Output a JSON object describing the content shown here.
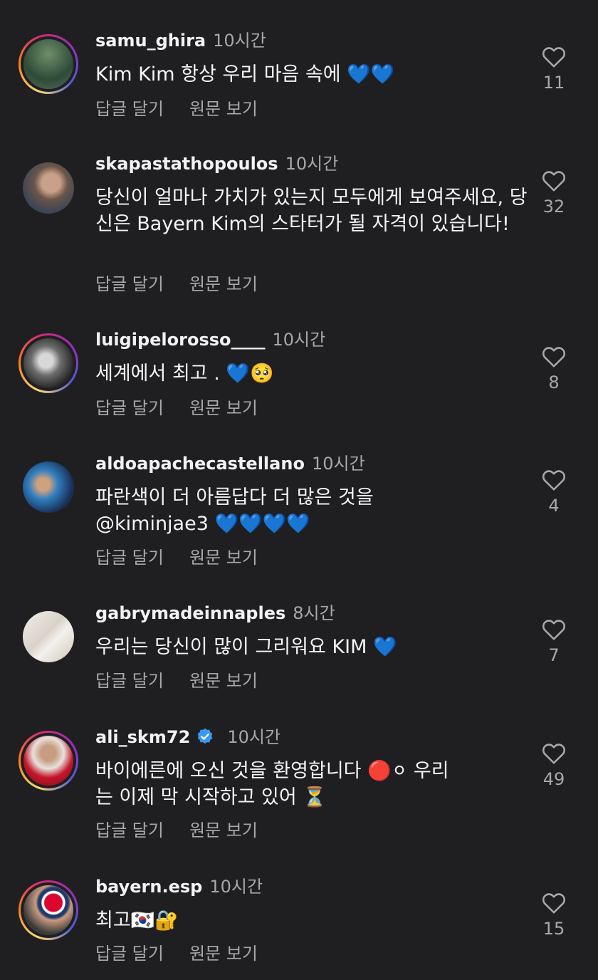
{
  "actions": {
    "reply": "답글 달기",
    "see_translation": "원문 보기"
  },
  "comments": [
    {
      "username": "samu_ghira",
      "time": "10시간",
      "text": "Kim Kim 항상 우리 마음 속에 ",
      "emoji": "💙💙",
      "likes": "11",
      "avatar_icon": "soccer-player-photo",
      "story_ring": true
    },
    {
      "username": "skapastathopoulos",
      "time": "10시간",
      "text": "당신이 얼마나 가치가 있는지 모두에게 보여주세요, 당신은 Bayern Kim의 스타터가 될 자격이 있습니다!",
      "emoji": "",
      "likes": "32",
      "avatar_icon": "man-portrait-photo",
      "story_ring": false
    },
    {
      "username": "luigipelorosso____",
      "time": "10시간",
      "text": "세계에서 최고 . ",
      "emoji": "💙🥺",
      "likes": "8",
      "avatar_icon": "man-bw-photo",
      "story_ring": true
    },
    {
      "username": "aldoapachecastellano",
      "time": "10시간",
      "text": "파란색이 더 아름답다 더 많은 것을 @kiminjae3 ",
      "emoji": "💙💙💙💙",
      "likes": "4",
      "avatar_icon": "man-trophy-photo",
      "story_ring": false
    },
    {
      "username": "gabrymadeinnaples",
      "time": "8시간",
      "text": "우리는 당신이 많이 그리워요 KIM ",
      "emoji": "💙",
      "likes": "7",
      "avatar_icon": "marble-photo",
      "story_ring": false
    },
    {
      "username": "ali_skm72",
      "time": "10시간",
      "verified": true,
      "text": "바이에른에 오신 것을 환영합니다 🔴⚪ 우리는 이제 막 시작하고 있어 ⏳",
      "emoji": "",
      "likes": "49",
      "avatar_icon": "man-bayern-jersey-photo",
      "story_ring": true
    },
    {
      "username": "bayern.esp",
      "time": "10시간",
      "text": "최고",
      "emoji": "🇰🇷🔐",
      "likes": "15",
      "avatar_icon": "bayern-logo-photo",
      "story_ring": true
    }
  ],
  "colors": {
    "background": "#1f1f22",
    "secondary_text": "#a8a8a8",
    "verified": "#3897f0",
    "heart_blue": "#29a8f2"
  }
}
